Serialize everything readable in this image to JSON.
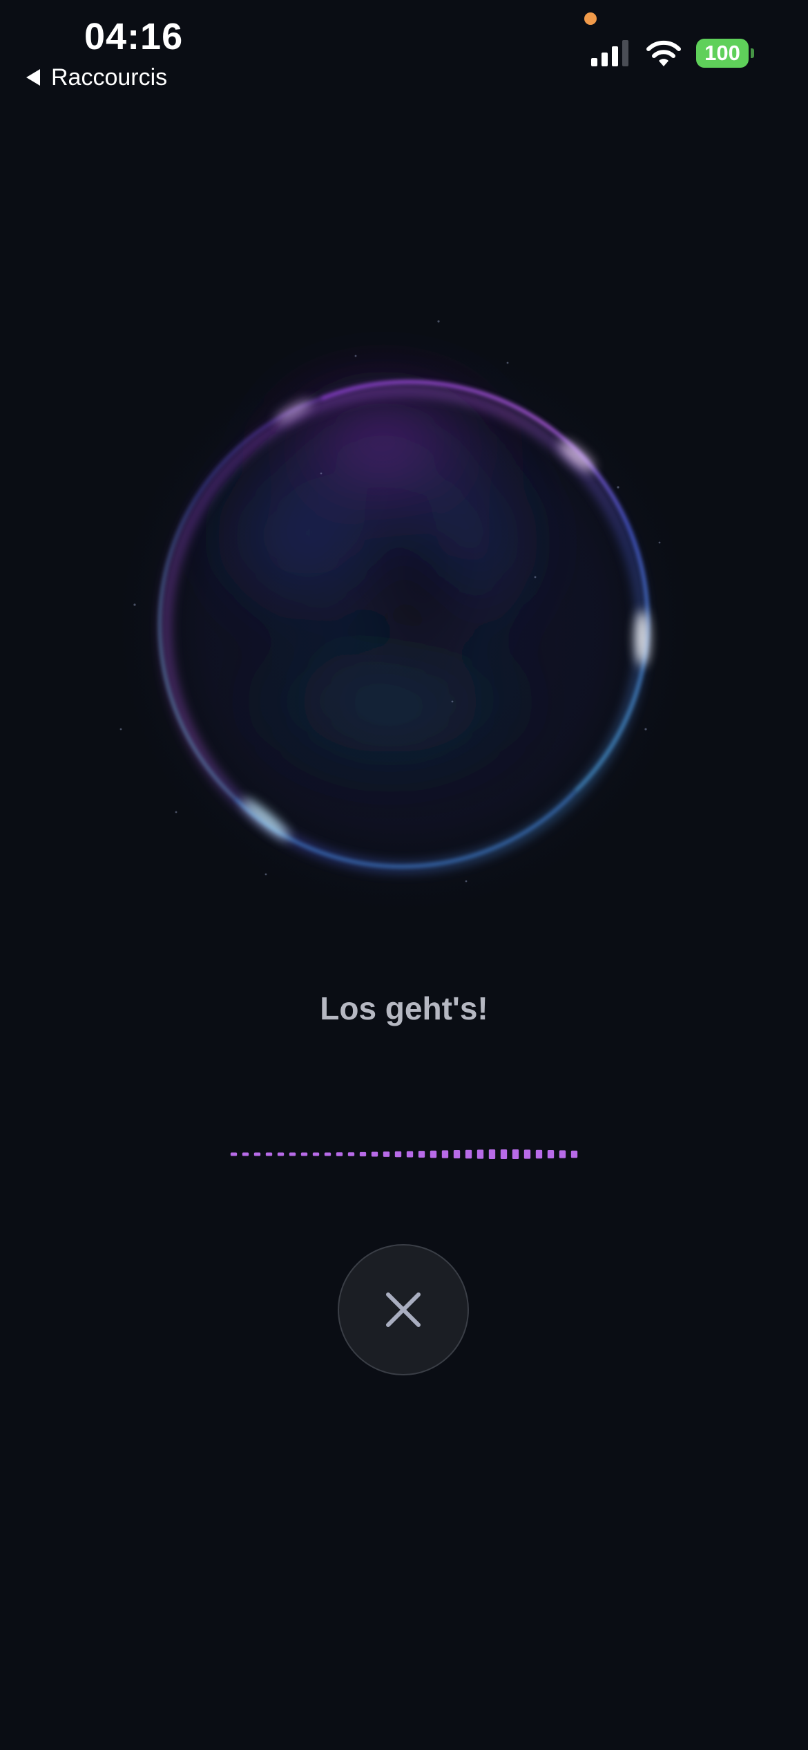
{
  "status_bar": {
    "time": "04:16",
    "back_label": "Raccourcis",
    "battery_level": "100",
    "battery_color": "#5fd05a",
    "privacy_dot_color": "#f19a4a",
    "icons": [
      "back-arrow-icon",
      "signal-icon",
      "wifi-icon",
      "battery-icon"
    ]
  },
  "orb": {
    "icon": "voice-orb",
    "colors": [
      "#8a3fd1",
      "#4a5bd8",
      "#3e9bb5",
      "#a7e6f0"
    ]
  },
  "prompt": {
    "text": "Los geht's!"
  },
  "waveform": {
    "color": "#b86be8",
    "levels": [
      0.35,
      0.35,
      0.35,
      0.35,
      0.35,
      0.35,
      0.35,
      0.35,
      0.35,
      0.4,
      0.4,
      0.45,
      0.5,
      0.55,
      0.6,
      0.65,
      0.7,
      0.75,
      0.8,
      0.85,
      0.9,
      0.95,
      1.0,
      1.0,
      1.0,
      0.95,
      0.9,
      0.85,
      0.8,
      0.75
    ]
  },
  "cancel_button": {
    "icon": "close-icon"
  }
}
